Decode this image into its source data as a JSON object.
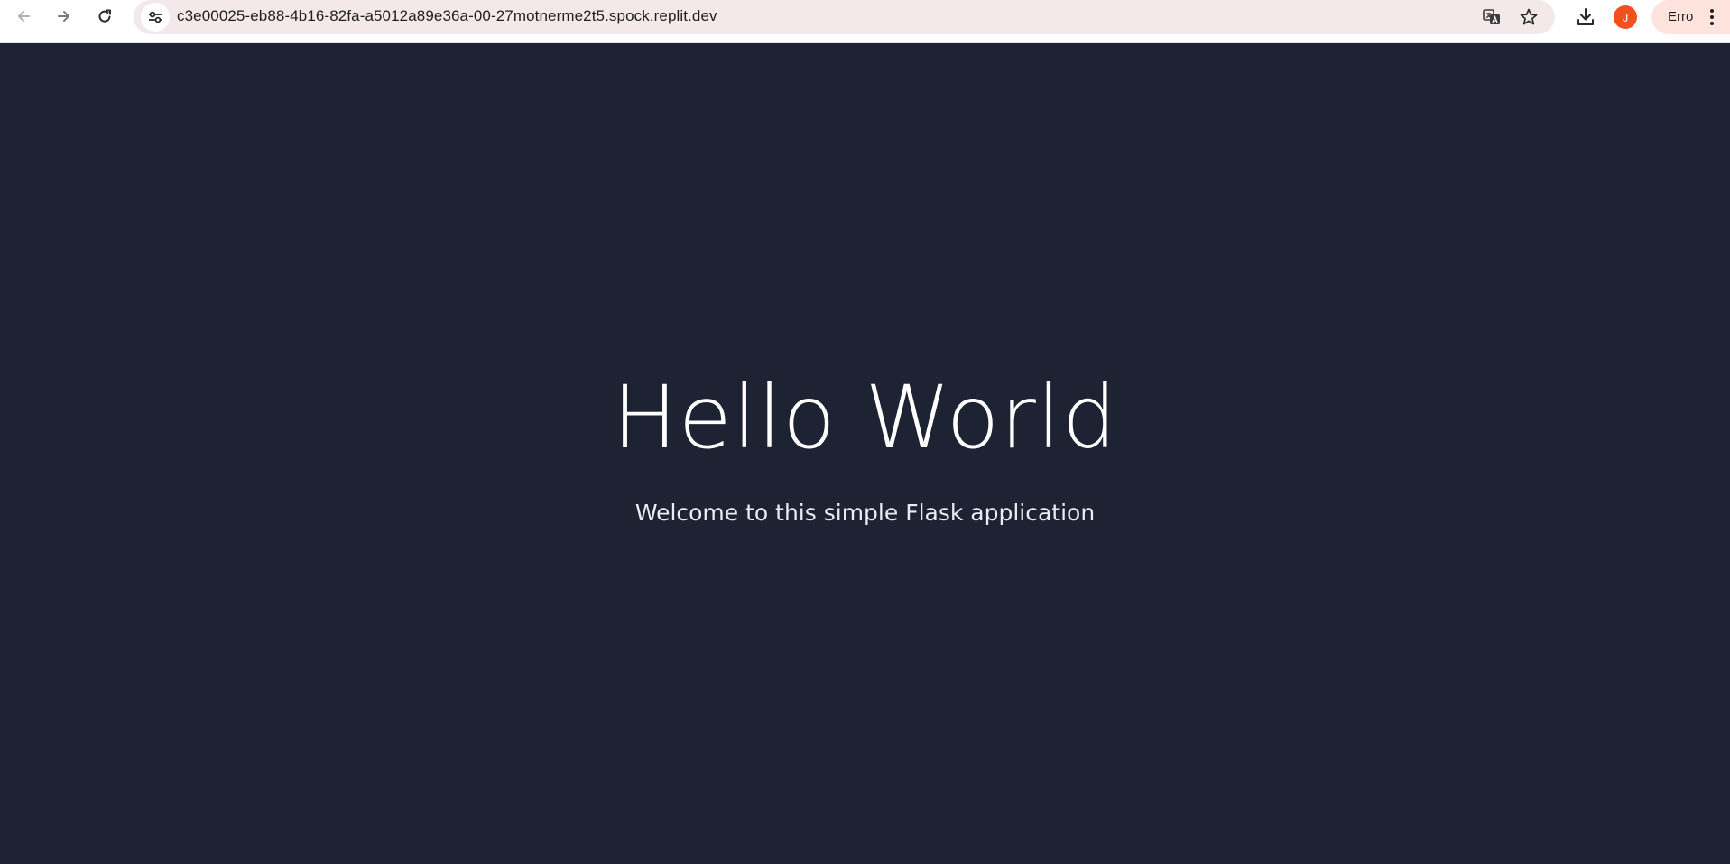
{
  "browser": {
    "url": "c3e00025-eb88-4b16-82fa-a5012a89e36a-00-27motnerme2t5.spock.replit.dev",
    "profile_initial": "J",
    "error_chip_label": "Erro",
    "icons": {
      "back": "arrow-left-icon",
      "forward": "arrow-right-icon",
      "reload": "reload-icon",
      "site_info": "tune-icon",
      "translate": "translate-icon",
      "bookmark": "star-icon",
      "downloads": "download-icon",
      "menu": "more-vertical-icon"
    },
    "colors": {
      "omnibox_bg": "#f3e9ea",
      "avatar_bg": "#f2501f",
      "error_chip_bg": "#fde3dc"
    }
  },
  "page": {
    "title": "Hello World",
    "subtitle": "Welcome to this simple Flask application",
    "background_color": "#1d2333"
  }
}
